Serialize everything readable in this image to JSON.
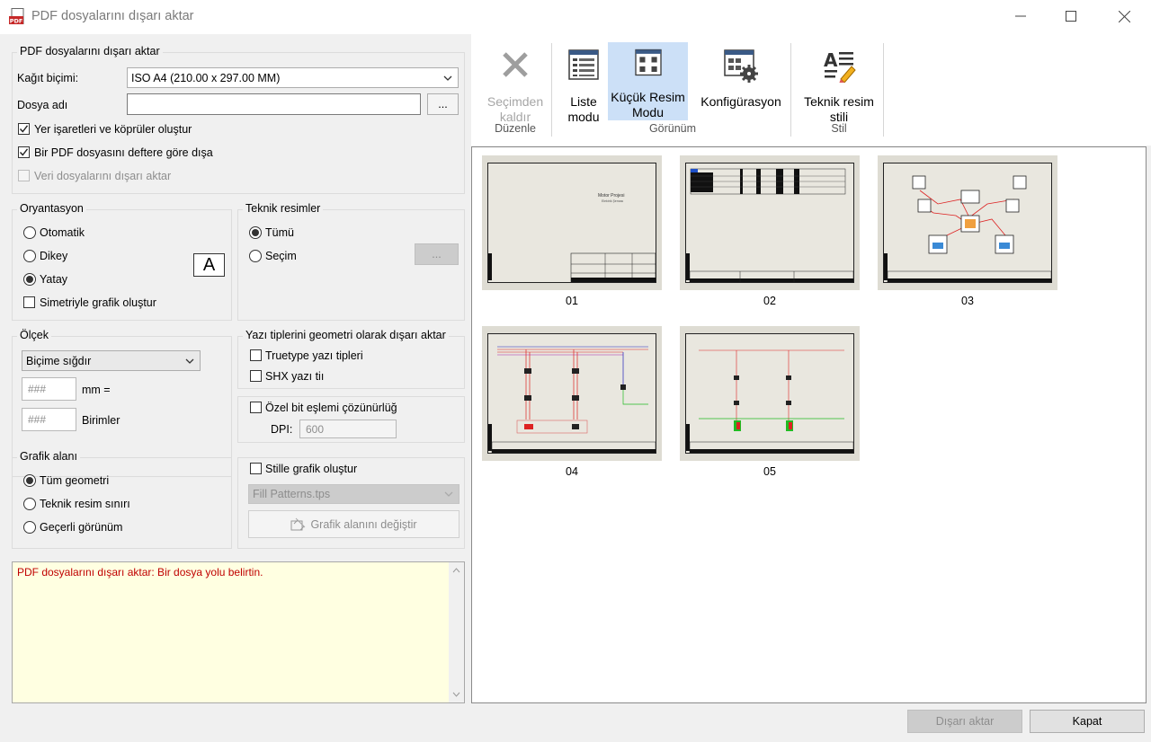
{
  "window": {
    "title": "PDF dosyalarını dışarı aktar"
  },
  "export": {
    "group_title": "PDF dosyalarını dışarı aktar",
    "paper_format_label": "Kağıt biçimi:",
    "paper_format_value": "ISO A4 (210.00 x 297.00 MM)",
    "file_name_label": "Dosya adı",
    "file_name_value": "",
    "browse_label": "...",
    "bookmarks_label": "Yer işaretleri ve köprüler oluştur",
    "bookmarks_checked": true,
    "per_book_label": "Bir PDF dosyasını deftere göre dışa",
    "per_book_checked": true,
    "data_files_label": "Veri dosyalarını dışarı aktar",
    "data_files_checked": false
  },
  "orientation": {
    "title": "Oryantasyon",
    "options": [
      "Otomatik",
      "Dikey",
      "Yatay"
    ],
    "selected": "Yatay",
    "symmetric_label": "Simetriyle grafik oluştur",
    "icon_letter": "A"
  },
  "drawings": {
    "title": "Teknik resimler",
    "options": [
      "Tümü",
      "Seçim"
    ],
    "selected": "Tümü",
    "selection_button": "..."
  },
  "scale": {
    "title": "Ölçek",
    "mode": "Biçime sığdır",
    "mm_value": "###",
    "mm_label": "mm =",
    "units_value": "###",
    "units_label": "Birimler"
  },
  "fonts": {
    "title": "Yazı tiplerini geometri olarak dışarı aktar",
    "truetype_label": "Truetype yazı tipleri",
    "shx_label": "SHX yazı tiı"
  },
  "bitmap": {
    "label": "Özel bit eşlemi çözünürlüğ",
    "dpi_label": "DPI:",
    "dpi_value": "600"
  },
  "graphic_area": {
    "title": "Grafik alanı",
    "options": [
      "Tüm geometri",
      "Teknik resim sınırı",
      "Geçerli görünüm"
    ],
    "selected": "Tüm geometri"
  },
  "style": {
    "label": "Stille grafik oluştur",
    "pattern_value": "Fill Patterns.tps",
    "change_area_label": "Grafik alanını değiştir"
  },
  "message": {
    "text": "PDF dosyalarını dışarı aktar: Bir dosya yolu belirtin.",
    "color": "#c00000"
  },
  "ribbon": {
    "remove_line1": "Seçimden",
    "remove_line2": "kaldır",
    "edit_group": "Düzenle",
    "list_line1": "Liste",
    "list_line2": "modu",
    "thumb_line1": "Küçük Resim",
    "thumb_line2": "Modu",
    "config_label": "Konfigürasyon",
    "view_group": "Görünüm",
    "style_line1": "Teknik resim",
    "style_line2": "stili",
    "style_group": "Stil",
    "active_color": "#cce0f7"
  },
  "thumbnails": [
    {
      "label": "01",
      "sheet_title": "Motor Projesi",
      "sheet_sub": "Elektrik Şeması"
    },
    {
      "label": "02"
    },
    {
      "label": "03"
    },
    {
      "label": "04"
    },
    {
      "label": "05"
    }
  ],
  "footer": {
    "export_label": "Dışarı aktar",
    "close_label": "Kapat"
  }
}
